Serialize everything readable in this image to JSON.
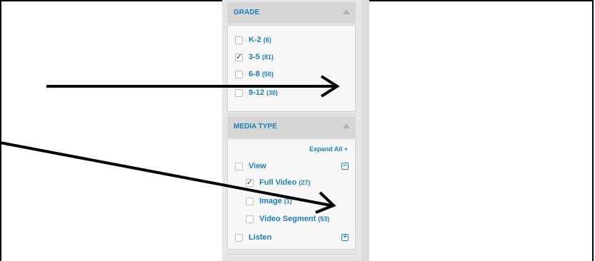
{
  "filters": {
    "grade": {
      "title": "GRADE",
      "items": [
        {
          "label": "K-2",
          "count": "(6)",
          "checked": false
        },
        {
          "label": "3-5",
          "count": "(81)",
          "checked": true
        },
        {
          "label": "6-8",
          "count": "(50)",
          "checked": false
        },
        {
          "label": "9-12",
          "count": "(30)",
          "checked": false
        }
      ]
    },
    "media_type": {
      "title": "MEDIA TYPE",
      "expand_all": "Expand All +",
      "view": {
        "label": "View",
        "toggle": "−"
      },
      "view_children": [
        {
          "label": "Full Video",
          "count": "(27)",
          "checked": true
        },
        {
          "label": "Image",
          "count": "(1)",
          "checked": false
        },
        {
          "label": "Video Segment",
          "count": "(53)",
          "checked": false
        }
      ],
      "listen": {
        "label": "Listen",
        "toggle": "+"
      }
    }
  },
  "colors": {
    "accent": "#1d7fb8",
    "panel_bg": "#e6e6e6",
    "arrow": "#000000"
  }
}
